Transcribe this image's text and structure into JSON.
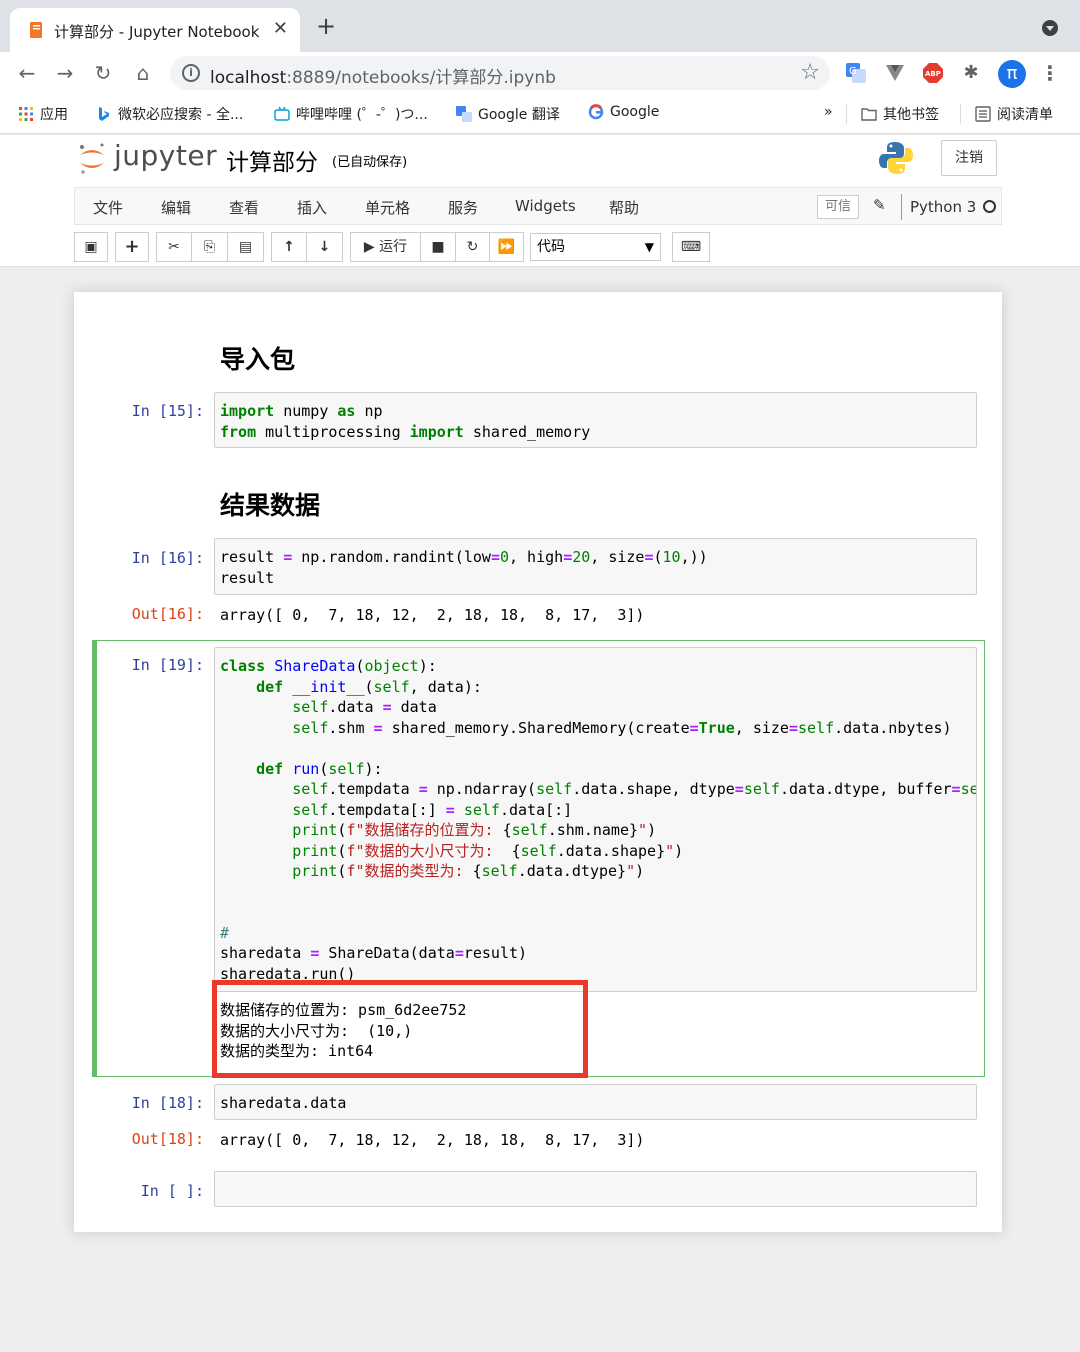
{
  "browser": {
    "tab_title": "计算部分 - Jupyter Notebook",
    "url_host": "localhost",
    "url_rest": ":8889/notebooks/计算部分.ipynb",
    "profile_initial": "π",
    "bookmarks": [
      "应用",
      "微软必应搜索 - 全...",
      "哔哩哔哩 (゜-゜)つ...",
      "Google 翻译",
      "Google"
    ],
    "other_bookmarks": "其他书签",
    "reading_list": "阅读清单",
    "more": "»"
  },
  "jupyter": {
    "logo_text": "jupyter",
    "notebook_name": "计算部分",
    "save_status": "(已自动保存)",
    "logout_label": "注销",
    "menu": [
      "文件",
      "编辑",
      "查看",
      "插入",
      "单元格",
      "服务",
      "Widgets",
      "帮助"
    ],
    "trusted_label": "可信",
    "kernel_name": "Python 3",
    "toolbar": {
      "run_label": "运行",
      "cell_type": "代码"
    }
  },
  "cells": {
    "heading1": "导入包",
    "in15_prompt": "In [15]:",
    "heading2": "结果数据",
    "in16_prompt": "In [16]:",
    "out16_prompt": "Out[16]:",
    "out16_text": "array([ 0,  7, 18, 12,  2, 18, 18,  8, 17,  3])",
    "in19_prompt": "In [19]:",
    "out19_lines": [
      "数据储存的位置为: psm_6d2ee752",
      "数据的大小尺寸为:  (10,)",
      "数据的类型为: int64"
    ],
    "in18_prompt": "In [18]:",
    "in18_code": "sharedata.data",
    "out18_prompt": "Out[18]:",
    "out18_text": "array([ 0,  7, 18, 12,  2, 18, 18,  8, 17,  3])",
    "empty_prompt": "In [ ]:"
  },
  "colors": {
    "selected_cell_border": "#66bb6a",
    "highlight_box": "#e8392b",
    "prompt_in": "#303f9f",
    "prompt_out": "#d84315"
  }
}
